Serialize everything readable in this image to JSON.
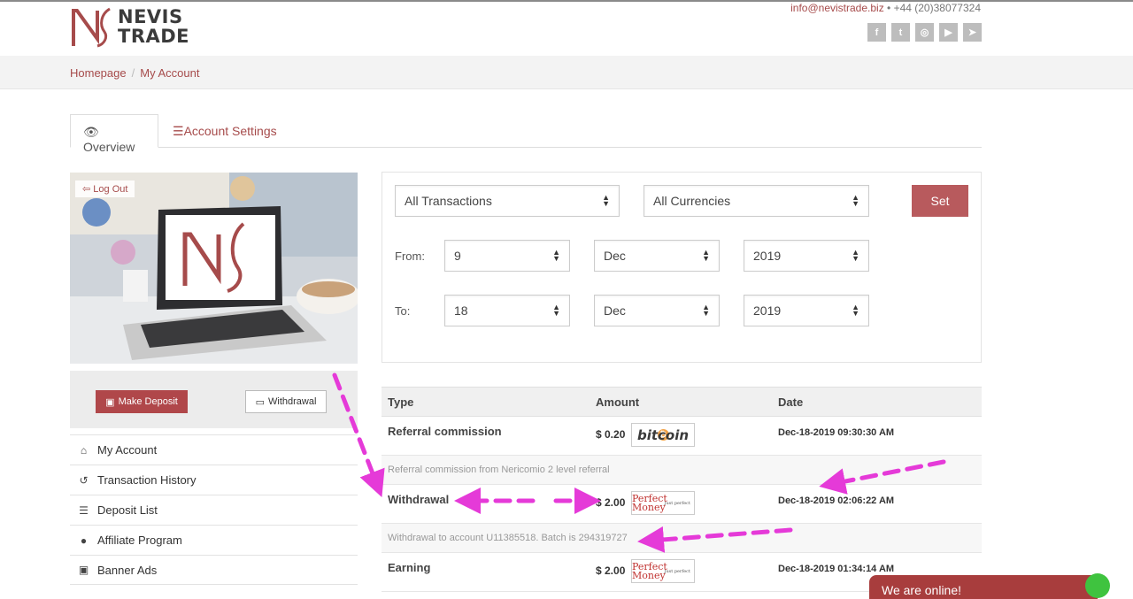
{
  "header": {
    "brand_line1": "NEVIS",
    "brand_line2": "TRADE",
    "email": "info@nevistrade.biz",
    "phone": " • +44 (20)38077324",
    "social": [
      {
        "icon": "facebook-icon",
        "glyph": "f"
      },
      {
        "icon": "twitter-icon",
        "glyph": "t"
      },
      {
        "icon": "instagram-icon",
        "glyph": "◎"
      },
      {
        "icon": "youtube-icon",
        "glyph": "▶"
      },
      {
        "icon": "telegram-icon",
        "glyph": "➤"
      }
    ]
  },
  "breadcrumb": {
    "home": "Homepage",
    "current": "My Account"
  },
  "tabs": {
    "overview": "Overview",
    "settings": "Account Settings"
  },
  "sidebar": {
    "logout": "Log Out",
    "deposit_label": "Make Deposit",
    "withdraw_label": "Withdrawal",
    "menu": [
      {
        "label": "My Account",
        "icon": "home-icon",
        "glyph": "⌂"
      },
      {
        "label": "Transaction History",
        "icon": "history-icon",
        "glyph": "↺"
      },
      {
        "label": "Deposit List",
        "icon": "list-icon",
        "glyph": "☰"
      },
      {
        "label": "Affiliate Program",
        "icon": "users-icon",
        "glyph": "●"
      },
      {
        "label": "Banner Ads",
        "icon": "image-icon",
        "glyph": "▣"
      }
    ]
  },
  "filter": {
    "type_value": "All Transactions",
    "currency_value": "All Currencies",
    "set_label": "Set",
    "from_label": "From:",
    "to_label": "To:",
    "from": {
      "day": "9",
      "month": "Dec",
      "year": "2019"
    },
    "to": {
      "day": "18",
      "month": "Dec",
      "year": "2019"
    }
  },
  "table": {
    "headers": {
      "type": "Type",
      "amount": "Amount",
      "date": "Date"
    },
    "rows": [
      {
        "type": "Referral commission",
        "amount": "$ 0.20",
        "method": "bitcoin",
        "date": "Dec-18-2019 09:30:30 AM",
        "note": "Referral commission from Nericomio 2 level referral"
      },
      {
        "type": "Withdrawal",
        "amount": "$ 2.00",
        "method": "Perfect Money",
        "date": "Dec-18-2019 02:06:22 AM",
        "note": "Withdrawal to account U11385518. Batch is 294319727"
      },
      {
        "type": "Earning",
        "amount": "$ 2.00",
        "method": "Perfect Money",
        "date": "Dec-18-2019 01:34:14 AM",
        "note": ""
      }
    ],
    "pm_tagline": "Just perfect"
  },
  "chat": {
    "label": "We are online!"
  },
  "colors": {
    "accent": "#a64b4b",
    "button": "#b0474a",
    "annotation": "#e53ad8"
  }
}
